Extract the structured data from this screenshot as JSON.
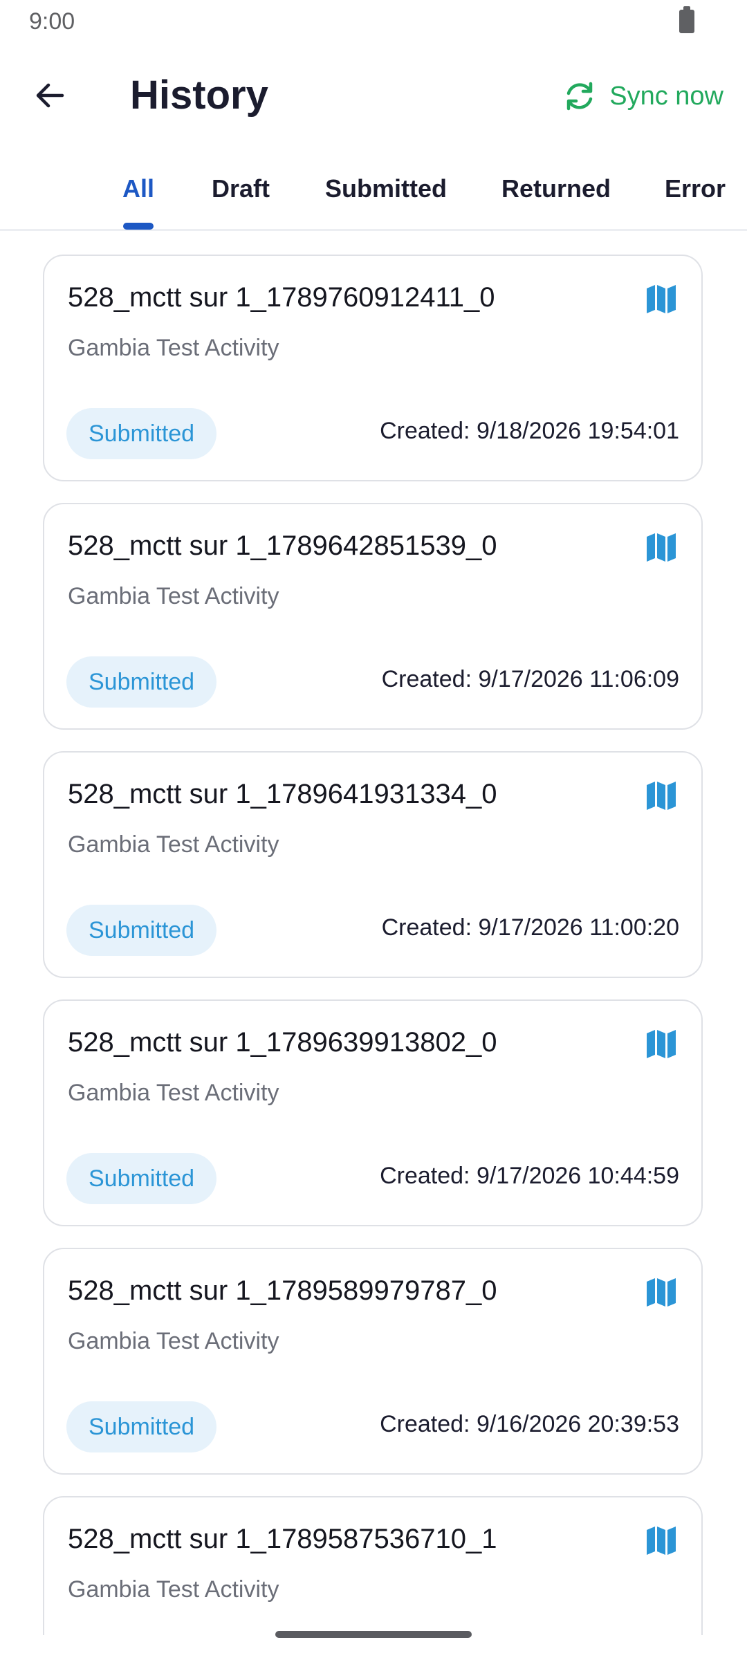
{
  "status_bar": {
    "time": "9:00"
  },
  "header": {
    "title": "History",
    "sync_label": "Sync now"
  },
  "tabs": [
    {
      "label": "All",
      "active": true
    },
    {
      "label": "Draft",
      "active": false
    },
    {
      "label": "Submitted",
      "active": false
    },
    {
      "label": "Returned",
      "active": false
    },
    {
      "label": "Error",
      "active": false
    }
  ],
  "records": [
    {
      "title": "528_mctt sur 1_1789760912411_0",
      "activity": "Gambia Test Activity",
      "status": "Submitted",
      "created": "Created: 9/18/2026 19:54:01"
    },
    {
      "title": "528_mctt sur 1_1789642851539_0",
      "activity": "Gambia Test Activity",
      "status": "Submitted",
      "created": "Created: 9/17/2026 11:06:09"
    },
    {
      "title": "528_mctt sur 1_1789641931334_0",
      "activity": "Gambia Test Activity",
      "status": "Submitted",
      "created": "Created: 9/17/2026 11:00:20"
    },
    {
      "title": "528_mctt sur 1_1789639913802_0",
      "activity": "Gambia Test Activity",
      "status": "Submitted",
      "created": "Created: 9/17/2026 10:44:59"
    },
    {
      "title": "528_mctt sur 1_1789589979787_0",
      "activity": "Gambia Test Activity",
      "status": "Submitted",
      "created": "Created: 9/16/2026 20:39:53"
    },
    {
      "title": "528_mctt sur 1_1789587536710_1",
      "activity": "Gambia Test Activity",
      "status": "",
      "created": ""
    }
  ],
  "icons": {
    "back": "arrow-left-icon",
    "sync": "sync-icon",
    "record": "map-icon"
  },
  "colors": {
    "primary": "#1d58c4",
    "sync_green": "#22a95d",
    "badge_bg": "#e6f2fb",
    "badge_text": "#2b95d6",
    "map_icon": "#2b95d6"
  }
}
